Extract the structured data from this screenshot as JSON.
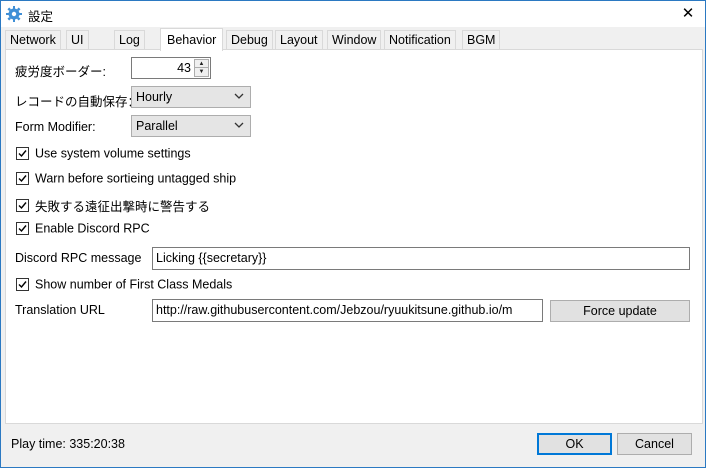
{
  "window": {
    "title": "設定",
    "close_glyph": "✕"
  },
  "tabs": [
    {
      "label": "Network"
    },
    {
      "label": "UI"
    },
    {
      "label": "Log"
    },
    {
      "label": "Behavior",
      "active": true
    },
    {
      "label": "Debug"
    },
    {
      "label": "Layout"
    },
    {
      "label": "Window"
    },
    {
      "label": "Notification"
    },
    {
      "label": "BGM"
    }
  ],
  "behavior": {
    "fatigue_border": {
      "label": "疲労度ボーダー:",
      "value": "43"
    },
    "record_autosave": {
      "label": "レコードの自動保存：",
      "value": "Hourly"
    },
    "form_modifier": {
      "label": "Form Modifier:",
      "value": "Parallel"
    },
    "checkboxes": {
      "system_volume": {
        "label": "Use system volume settings",
        "checked": true
      },
      "warn_untagged": {
        "label": "Warn before sortieing untagged ship",
        "checked": true
      },
      "warn_failure": {
        "label": "失敗する遠征出撃時に警告する",
        "checked": true
      },
      "discord_rpc": {
        "label": "Enable Discord RPC",
        "checked": true
      },
      "first_class_medals": {
        "label": "Show number of First Class Medals",
        "checked": true
      }
    },
    "discord_message": {
      "label": "Discord RPC message",
      "value": "Licking {{secretary}}"
    },
    "translation_url": {
      "label": "Translation URL",
      "value": "http://raw.githubusercontent.com/Jebzou/ryuukitsune.github.io/m",
      "button": "Force update"
    }
  },
  "footer": {
    "play_time": "Play time: 335:20:38",
    "ok": "OK",
    "cancel": "Cancel"
  },
  "colors": {
    "accent": "#0078d7",
    "title_border": "#2b79c2"
  },
  "icons": {
    "app": "gear-icon",
    "close": "close-icon",
    "dropdown": "chevron-down-icon",
    "check": "checkmark-icon"
  }
}
